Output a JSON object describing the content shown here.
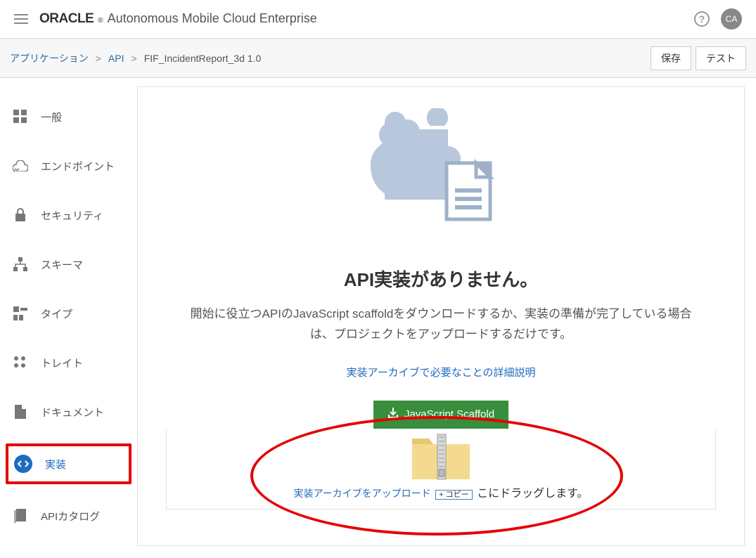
{
  "header": {
    "brand": "ORACLE",
    "product": "Autonomous Mobile Cloud Enterprise",
    "avatar_initials": "CA",
    "help_char": "?"
  },
  "breadcrumb": {
    "app_label": "アプリケーション",
    "api_label": "API",
    "current": "FIF_IncidentReport_3d  1.0"
  },
  "actions": {
    "save": "保存",
    "test": "テスト"
  },
  "sidebar": {
    "items": [
      {
        "id": "general",
        "label": "一般"
      },
      {
        "id": "endpoints",
        "label": "エンドポイント"
      },
      {
        "id": "security",
        "label": "セキュリティ"
      },
      {
        "id": "schema",
        "label": "スキーマ"
      },
      {
        "id": "types",
        "label": "タイプ"
      },
      {
        "id": "traits",
        "label": "トレイト"
      },
      {
        "id": "documents",
        "label": "ドキュメント"
      },
      {
        "id": "implementation",
        "label": "実装"
      },
      {
        "id": "api-catalog",
        "label": "APIカタログ"
      }
    ]
  },
  "empty": {
    "title": "API実装がありません。",
    "description": "開始に役立つAPIのJavaScript scaffoldをダウンロードするか、実装の準備が完了している場合は、プロジェクトをアップロードするだけです。",
    "info_link": "実装アーカイブで必要なことの詳細説明",
    "scaffold_button": "JavaScript Scaffold",
    "drop_prefix": "実装アーカイブをアップロード",
    "copy_label": "+ コピー",
    "drop_suffix": "こにドラッグします。"
  }
}
